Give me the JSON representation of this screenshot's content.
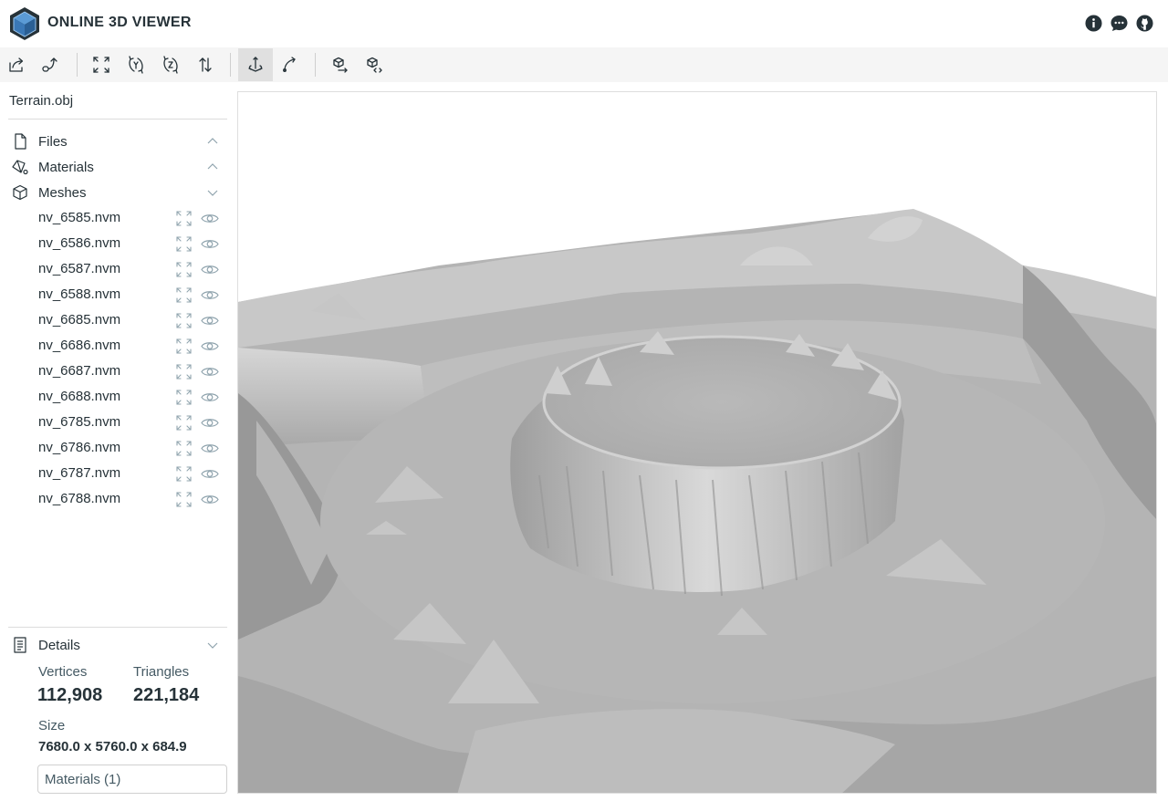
{
  "header": {
    "title": "ONLINE 3D VIEWER",
    "icons": [
      "info-icon",
      "message-icon",
      "github-icon"
    ]
  },
  "toolbar": {
    "buttons": [
      {
        "name": "open-file",
        "icon": "open-file-icon"
      },
      {
        "name": "open-url",
        "icon": "open-url-icon"
      },
      {
        "name": "fit-to-window",
        "icon": "fit-icon"
      },
      {
        "name": "set-up-vector-y",
        "icon": "up-y-icon"
      },
      {
        "name": "set-up-vector-z",
        "icon": "up-z-icon"
      },
      {
        "name": "flip-up-vector",
        "icon": "flip-icon"
      },
      {
        "name": "fixed-up-vector",
        "icon": "fixed-up-icon",
        "selected": true
      },
      {
        "name": "free-orbit",
        "icon": "free-orbit-icon"
      },
      {
        "name": "export",
        "icon": "export-icon"
      },
      {
        "name": "share",
        "icon": "share-icon"
      }
    ]
  },
  "navigator": {
    "file_name": "Terrain.obj",
    "panels": {
      "files": "Files",
      "materials": "Materials",
      "meshes": "Meshes",
      "details": "Details"
    },
    "meshes": [
      "nv_6585.nvm",
      "nv_6586.nvm",
      "nv_6587.nvm",
      "nv_6588.nvm",
      "nv_6685.nvm",
      "nv_6686.nvm",
      "nv_6687.nvm",
      "nv_6688.nvm",
      "nv_6785.nvm",
      "nv_6786.nvm",
      "nv_6787.nvm",
      "nv_6788.nvm"
    ]
  },
  "details": {
    "vertices_label": "Vertices",
    "vertices": "112,908",
    "triangles_label": "Triangles",
    "triangles": "221,184",
    "size_label": "Size",
    "size": "7680.0 x 5760.0 x 684.9",
    "materials_button": "Materials (1)"
  },
  "colors": {
    "accent": "#263238",
    "toolbar_bg": "#f5f5f5",
    "selected_bg": "#e0e0e0",
    "terrain": "#b4b4b4"
  }
}
